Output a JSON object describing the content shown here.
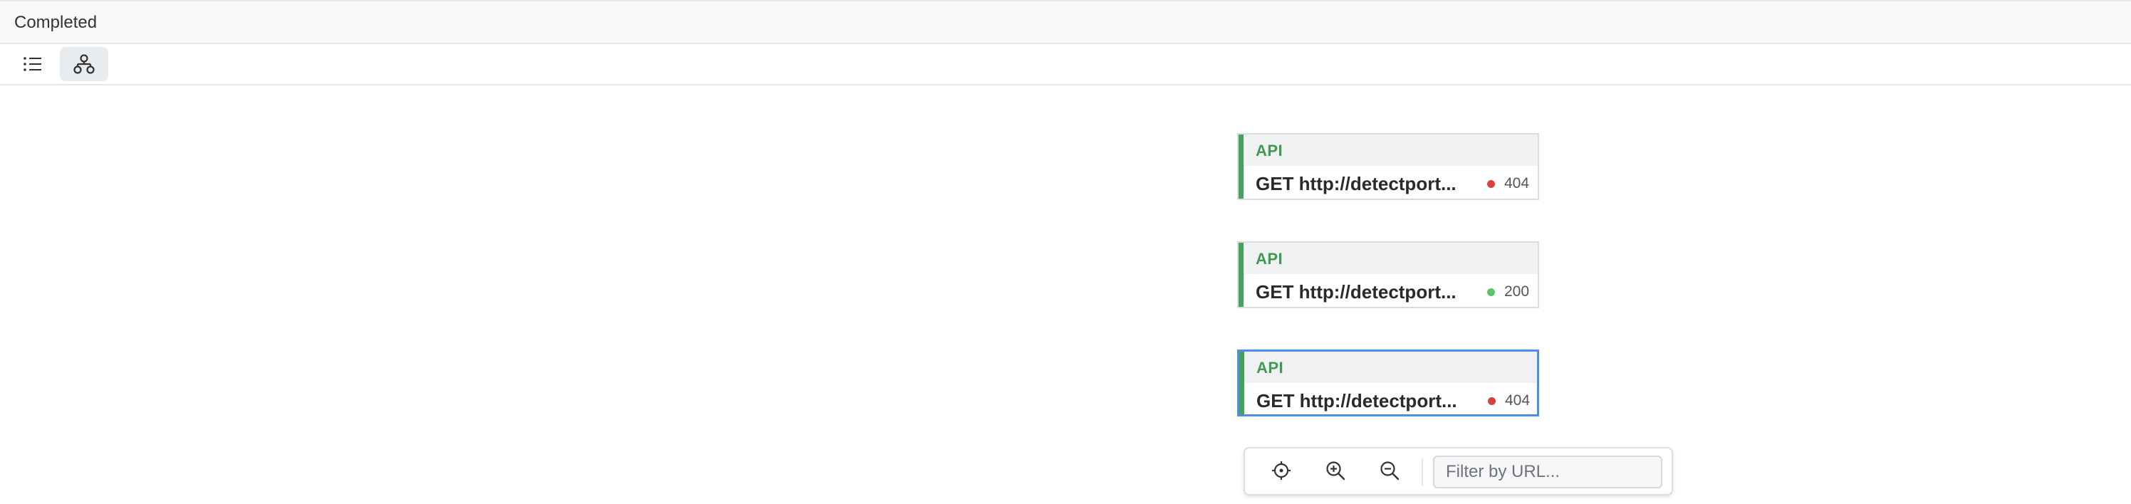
{
  "header": {
    "status": "Completed"
  },
  "toolbar": {
    "views": [
      {
        "name": "list-view",
        "icon": "list-icon",
        "active": false
      },
      {
        "name": "graph-view",
        "icon": "sitemap-icon",
        "active": true
      }
    ]
  },
  "nodes": [
    {
      "type": "API",
      "url": "GET http://detectport...",
      "status_code": "404",
      "status_color": "#d9413a",
      "selected": false
    },
    {
      "type": "API",
      "url": "GET http://detectport...",
      "status_code": "200",
      "status_color": "#5cc26c",
      "selected": false
    },
    {
      "type": "API",
      "url": "GET http://detectport...",
      "status_code": "404",
      "status_color": "#d9413a",
      "selected": true
    }
  ],
  "controls": {
    "buttons": [
      "center-icon",
      "zoom-in-icon",
      "zoom-out-icon"
    ],
    "filter_placeholder": "Filter by URL...",
    "filter_value": ""
  },
  "colors": {
    "accent_green": "#46a15a",
    "selection_blue": "#4a8ee6",
    "error_red": "#d9413a",
    "success_green": "#5cc26c"
  }
}
